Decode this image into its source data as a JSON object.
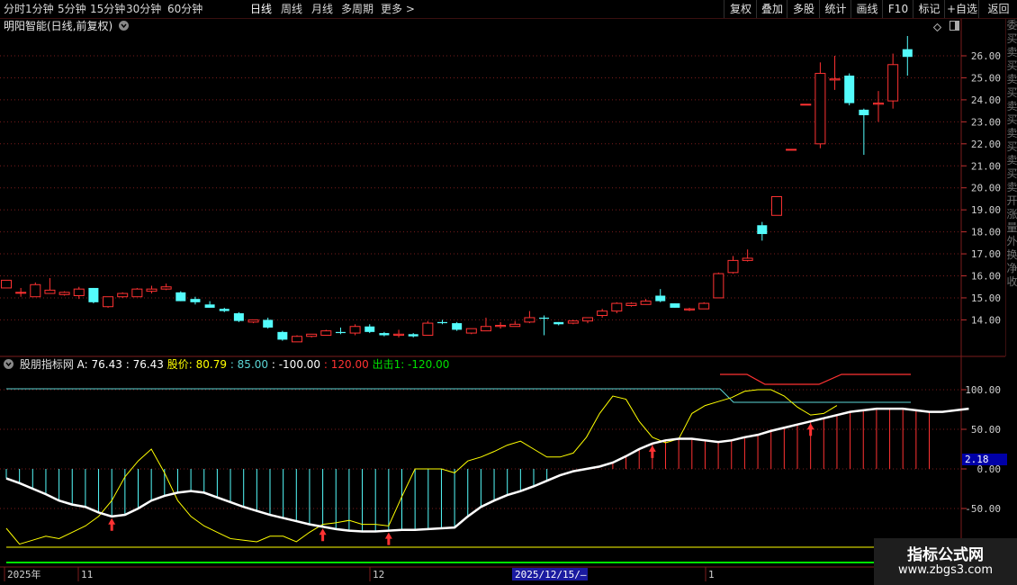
{
  "toolbar": {
    "periods": [
      "分时",
      "1分钟",
      "5分钟",
      "15分钟",
      "30分钟",
      "60分钟",
      "日线",
      "周线",
      "月线",
      "多周期",
      "更多 >"
    ],
    "active_period": "日线",
    "right_buttons": [
      "复权",
      "叠加",
      "多股",
      "统计",
      "画线",
      "F10",
      "标记",
      "+自选",
      "返回"
    ]
  },
  "main_chart": {
    "title": "明阳智能(日线,前复权)",
    "price_ticks": [
      "26.00",
      "25.00",
      "24.00",
      "23.00",
      "22.00",
      "21.00",
      "20.00",
      "19.00",
      "18.00",
      "17.00",
      "16.00",
      "15.00",
      "14.00"
    ],
    "price_tick_values": [
      26,
      25,
      24,
      23,
      22,
      21,
      20,
      19,
      18,
      17,
      16,
      15,
      14
    ],
    "candles": [
      [
        15.45,
        15.8,
        15.45,
        15.8
      ],
      [
        15.25,
        15.45,
        15.05,
        15.25
      ],
      [
        15.05,
        15.7,
        15.05,
        15.6
      ],
      [
        15.2,
        15.9,
        15.2,
        15.35
      ],
      [
        15.15,
        15.3,
        15.1,
        15.25
      ],
      [
        15.1,
        15.5,
        14.95,
        15.4
      ],
      [
        15.45,
        15.45,
        14.75,
        14.8
      ],
      [
        14.6,
        15.05,
        14.55,
        15.05
      ],
      [
        15.05,
        15.25,
        15.0,
        15.2
      ],
      [
        15.05,
        15.45,
        15.05,
        15.4
      ],
      [
        15.3,
        15.55,
        15.2,
        15.4
      ],
      [
        15.4,
        15.65,
        15.35,
        15.5
      ],
      [
        15.25,
        15.3,
        14.85,
        14.85
      ],
      [
        14.95,
        15.05,
        14.7,
        14.8
      ],
      [
        14.7,
        14.85,
        14.55,
        14.55
      ],
      [
        14.5,
        14.55,
        14.35,
        14.4
      ],
      [
        14.3,
        14.35,
        13.9,
        13.95
      ],
      [
        13.9,
        14.0,
        13.85,
        14.0
      ],
      [
        14.0,
        14.1,
        13.6,
        13.65
      ],
      [
        13.45,
        13.5,
        13.05,
        13.1
      ],
      [
        13.0,
        13.3,
        13.0,
        13.25
      ],
      [
        13.25,
        13.35,
        13.2,
        13.35
      ],
      [
        13.3,
        13.55,
        13.3,
        13.5
      ],
      [
        13.45,
        13.65,
        13.35,
        13.4
      ],
      [
        13.4,
        13.8,
        13.3,
        13.7
      ],
      [
        13.7,
        13.8,
        13.4,
        13.45
      ],
      [
        13.4,
        13.45,
        13.25,
        13.3
      ],
      [
        13.3,
        13.55,
        13.2,
        13.35
      ],
      [
        13.35,
        13.4,
        13.2,
        13.25
      ],
      [
        13.3,
        13.95,
        13.3,
        13.85
      ],
      [
        13.9,
        14.0,
        13.8,
        13.85
      ],
      [
        13.85,
        13.9,
        13.5,
        13.55
      ],
      [
        13.4,
        13.6,
        13.35,
        13.6
      ],
      [
        13.5,
        14.1,
        13.5,
        13.7
      ],
      [
        13.7,
        13.9,
        13.6,
        13.75
      ],
      [
        13.7,
        13.95,
        13.7,
        13.8
      ],
      [
        13.9,
        14.4,
        13.85,
        14.1
      ],
      [
        14.1,
        14.2,
        13.3,
        14.05
      ],
      [
        13.9,
        13.9,
        13.75,
        13.8
      ],
      [
        13.85,
        14.0,
        13.8,
        13.95
      ],
      [
        13.95,
        14.1,
        13.85,
        14.1
      ],
      [
        14.2,
        14.5,
        14.1,
        14.4
      ],
      [
        14.4,
        14.8,
        14.3,
        14.75
      ],
      [
        14.65,
        14.8,
        14.6,
        14.75
      ],
      [
        14.7,
        14.95,
        14.7,
        14.85
      ],
      [
        15.1,
        15.4,
        14.8,
        14.85
      ],
      [
        14.75,
        14.75,
        14.55,
        14.55
      ],
      [
        14.45,
        14.55,
        14.4,
        14.5
      ],
      [
        14.5,
        14.8,
        14.5,
        14.75
      ],
      [
        15.0,
        16.15,
        15.0,
        16.1
      ],
      [
        16.15,
        16.9,
        16.1,
        16.7
      ],
      [
        16.7,
        17.2,
        16.65,
        16.8
      ],
      [
        18.3,
        18.45,
        17.6,
        17.9
      ],
      [
        18.75,
        19.6,
        18.75,
        19.6
      ],
      [
        21.75,
        21.75,
        21.75,
        21.75
      ],
      [
        23.8,
        23.8,
        23.8,
        23.8
      ],
      [
        22.0,
        25.7,
        21.8,
        25.2
      ],
      [
        24.9,
        26.0,
        24.45,
        24.95
      ],
      [
        25.1,
        25.2,
        23.75,
        23.85
      ],
      [
        23.55,
        23.6,
        21.5,
        23.3
      ],
      [
        23.8,
        24.4,
        23.0,
        23.85
      ],
      [
        23.95,
        26.1,
        23.6,
        25.6
      ],
      [
        26.3,
        26.9,
        25.1,
        25.95
      ]
    ],
    "last_price": "26.00"
  },
  "indicator": {
    "name": "股朋指标网",
    "label_a": "A: 76.43",
    "value_a2": ": 76.43",
    "label_price": "股价: 80.79",
    "value_85": ": 85.00",
    "value_m100": ": -100.00",
    "value_120": ": 120.00",
    "label_exit": "出击1: -120.00",
    "ticks": [
      "100.00",
      "50.00",
      "0.00",
      "-50.00"
    ],
    "tick_values": [
      100,
      50,
      0,
      -50
    ],
    "marker_value": "2.18",
    "a_line": [
      -12,
      -18,
      -25,
      -32,
      -40,
      -45,
      -48,
      -55,
      -60,
      -58,
      -50,
      -40,
      -34,
      -30,
      -28,
      -30,
      -36,
      -42,
      -48,
      -53,
      -58,
      -62,
      -66,
      -70,
      -73,
      -76,
      -78,
      -79,
      -79,
      -78,
      -77,
      -77,
      -76,
      -75,
      -74,
      -60,
      -48,
      -40,
      -33,
      -28,
      -22,
      -15,
      -8,
      -3,
      0,
      3,
      8,
      16,
      25,
      32,
      36,
      38,
      38,
      36,
      34,
      36,
      40,
      43,
      48,
      52,
      56,
      60,
      64,
      68,
      72,
      74,
      76,
      76,
      76,
      74,
      72,
      72,
      74,
      76
    ],
    "price_line": [
      -75,
      -95,
      -90,
      -85,
      -88,
      -80,
      -72,
      -60,
      -40,
      -10,
      10,
      25,
      -5,
      -40,
      -60,
      -72,
      -80,
      -88,
      -90,
      -92,
      -85,
      -85,
      -92,
      -80,
      -70,
      -68,
      -65,
      -70,
      -70,
      -72,
      -35,
      0,
      0,
      0,
      -5,
      10,
      15,
      22,
      30,
      35,
      25,
      15,
      15,
      20,
      40,
      70,
      92,
      88,
      60,
      40,
      33,
      38,
      70,
      80,
      85,
      90,
      98,
      100,
      100,
      92,
      78,
      68,
      70,
      80
    ],
    "hist": [
      -0.9,
      -0.9,
      -0.9,
      -0.9,
      -0.9,
      -0.9,
      -0.9,
      -0.9,
      -0.9,
      -0.9,
      -0.9,
      -0.9,
      -0.9,
      -0.9,
      -0.9,
      -0.9,
      -0.9,
      -0.9,
      -0.9,
      -0.9,
      -0.9,
      -0.9,
      -0.9,
      -0.9,
      -0.9,
      -0.9,
      -0.9,
      -0.9,
      -0.9,
      -0.9,
      -0.9,
      -0.9,
      -0.9,
      -0.9,
      -0.9,
      -0.9,
      -0.9,
      -0.9,
      -0.9,
      -0.9,
      -0.9,
      -0.9,
      0,
      0,
      0,
      0,
      1,
      1,
      1,
      1,
      1,
      1,
      1,
      1,
      1,
      1,
      1,
      1,
      1,
      1,
      1,
      1,
      1,
      1,
      1,
      1,
      1,
      1,
      1,
      1,
      1
    ],
    "arrows": [
      8,
      24,
      29,
      49,
      61
    ]
  },
  "date_axis": {
    "labels": [
      "2025年",
      "11",
      "12",
      "2025/12/15/—",
      "1"
    ]
  },
  "watermark": {
    "line1": "指标公式网",
    "line2": "www.zbgs3.com"
  },
  "right_strip": [
    "委",
    "买",
    "卖",
    "买",
    "卖",
    "买",
    "卖",
    "买",
    "卖",
    "买",
    "卖",
    "买",
    "卖",
    "开",
    "涨",
    "量",
    "外",
    "换",
    "净",
    "收"
  ],
  "colors": {
    "up": "#ff3232",
    "down": "#54fcfc",
    "white": "#ffffff",
    "yellow": "#ffff00",
    "cyan_line": "#5bd6d6",
    "green": "#00e000",
    "grid": "#7a1c1c"
  }
}
